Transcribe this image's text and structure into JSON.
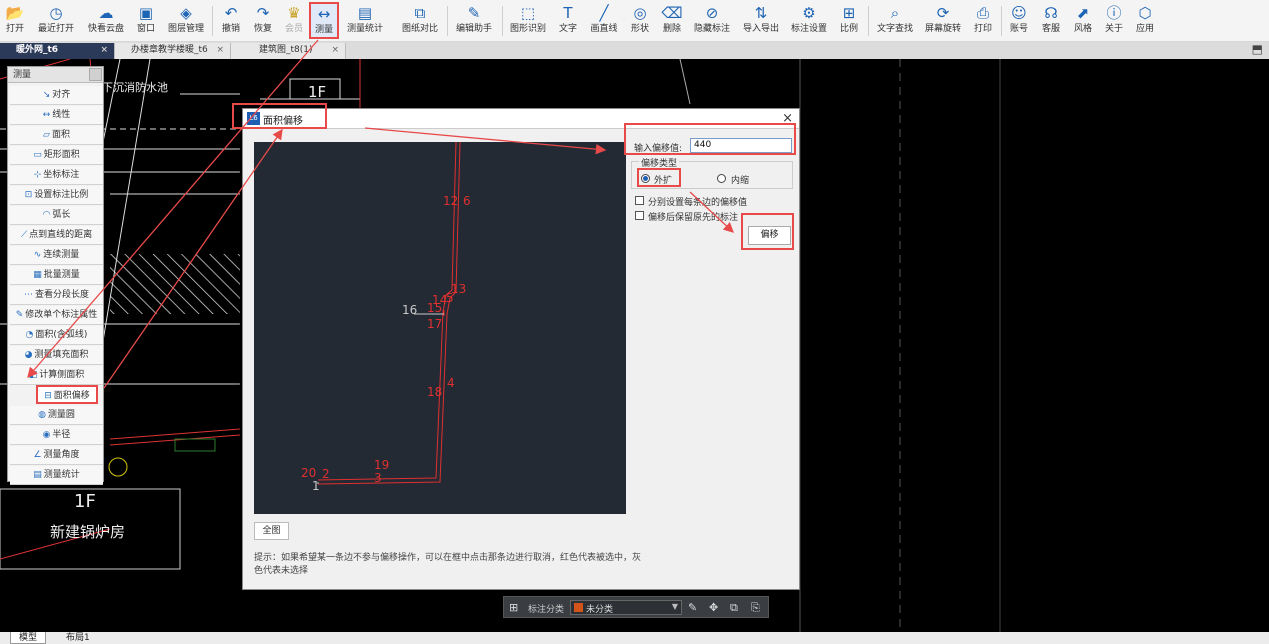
{
  "toolbar": {
    "items": [
      {
        "label": "打开",
        "icon": "folder-icon"
      },
      {
        "label": "最近打开",
        "icon": "clock-icon"
      },
      {
        "label": "快看云盘",
        "icon": "cloud-icon"
      },
      {
        "label": "窗口",
        "icon": "window-icon"
      },
      {
        "label": "图层管理",
        "icon": "layers-icon"
      },
      {
        "label": "撤销",
        "icon": "undo-icon"
      },
      {
        "label": "恢复",
        "icon": "redo-icon"
      },
      {
        "label": "会员",
        "icon": "vip-icon"
      },
      {
        "label": "测量",
        "icon": "measure-icon"
      },
      {
        "label": "测量统计",
        "icon": "measure-stats-icon"
      },
      {
        "label": "图纸对比",
        "icon": "compare-icon"
      },
      {
        "label": "编辑助手",
        "icon": "edit-assistant-icon"
      },
      {
        "label": "图形识别",
        "icon": "shape-recognize-icon"
      },
      {
        "label": "文字",
        "icon": "text-icon"
      },
      {
        "label": "画直线",
        "icon": "line-icon"
      },
      {
        "label": "形状",
        "icon": "shape-icon"
      },
      {
        "label": "删除",
        "icon": "eraser-icon"
      },
      {
        "label": "隐藏标注",
        "icon": "hide-annotation-icon"
      },
      {
        "label": "导入导出",
        "icon": "import-export-icon"
      },
      {
        "label": "标注设置",
        "icon": "annotation-settings-icon"
      },
      {
        "label": "比例",
        "icon": "scale-icon"
      },
      {
        "label": "文字查找",
        "icon": "text-search-icon"
      },
      {
        "label": "屏幕旋转",
        "icon": "rotate-screen-icon"
      },
      {
        "label": "打印",
        "icon": "print-icon"
      },
      {
        "label": "账号",
        "icon": "user-icon"
      },
      {
        "label": "客服",
        "icon": "headset-icon"
      },
      {
        "label": "风格",
        "icon": "style-icon"
      },
      {
        "label": "关于",
        "icon": "info-icon"
      },
      {
        "label": "应用",
        "icon": "cube-icon"
      }
    ]
  },
  "tabs": [
    {
      "label": "暖外网_t6",
      "active": true
    },
    {
      "label": "办楼章教学楼暖_t6",
      "active": false
    },
    {
      "label": "建筑图_t8(1)",
      "active": false
    }
  ],
  "canvas": {
    "labels": {
      "pool": "下沉消防水池",
      "floor_top": "1F",
      "floor_bottom": "1F",
      "boiler": "新建锅炉房"
    }
  },
  "measure_panel": {
    "title": "测量",
    "items": [
      {
        "label": "对齐",
        "icon": "align-icon"
      },
      {
        "label": "线性",
        "icon": "linear-icon"
      },
      {
        "label": "面积",
        "icon": "area-icon"
      },
      {
        "label": "矩形面积",
        "icon": "rect-area-icon"
      },
      {
        "label": "坐标标注",
        "icon": "coordinate-icon"
      },
      {
        "label": "设置标注比例",
        "icon": "scale-setting-icon"
      },
      {
        "label": "弧长",
        "icon": "arc-icon"
      },
      {
        "label": "点到直线的距离",
        "icon": "point-line-icon"
      },
      {
        "label": "连续测量",
        "icon": "continuous-icon"
      },
      {
        "label": "批量测量",
        "icon": "batch-icon"
      },
      {
        "label": "查看分段长度",
        "icon": "segment-icon"
      },
      {
        "label": "修改单个标注属性",
        "icon": "edit-annotation-icon"
      },
      {
        "label": "面积(含弧线)",
        "icon": "arc-area-icon"
      },
      {
        "label": "测量填充面积",
        "icon": "fill-area-icon"
      },
      {
        "label": "计算侧面积",
        "icon": "side-area-icon"
      },
      {
        "label": "面积偏移",
        "icon": "area-offset-icon"
      },
      {
        "label": "测量圆",
        "icon": "circle-icon"
      },
      {
        "label": "半径",
        "icon": "radius-icon"
      },
      {
        "label": "测量角度",
        "icon": "angle-icon"
      },
      {
        "label": "测量统计",
        "icon": "stats-icon"
      }
    ]
  },
  "dialog": {
    "title": "面积偏移",
    "offset_label": "输入偏移值:",
    "offset_value": "440",
    "offset_type_label": "偏移类型",
    "radio_outer": "外扩",
    "radio_inner": "内缩",
    "selected_type": "外扩",
    "checkbox1": "分别设置每条边的偏移值",
    "checkbox2": "偏移后保留原先的标注",
    "offset_button": "偏移",
    "full_button": "全图",
    "hint": "提示：如果希望某一条边不参与偏移操作，可以在框中点击那条边进行取消，红色代表被选中，灰色代表未选择",
    "preview_labels": [
      {
        "text": "12",
        "color": "#e03030"
      },
      {
        "text": "6",
        "color": "#e03030"
      },
      {
        "text": "13",
        "color": "#e03030"
      },
      {
        "text": "14",
        "color": "#e03030"
      },
      {
        "text": "5",
        "color": "#e03030"
      },
      {
        "text": "16",
        "color": "#c8c8c8"
      },
      {
        "text": "15",
        "color": "#e03030"
      },
      {
        "text": "17",
        "color": "#e03030"
      },
      {
        "text": "18",
        "color": "#e03030"
      },
      {
        "text": "4",
        "color": "#e03030"
      },
      {
        "text": "19",
        "color": "#e03030"
      },
      {
        "text": "20",
        "color": "#e03030"
      },
      {
        "text": "2",
        "color": "#e03030"
      },
      {
        "text": "3",
        "color": "#e03030"
      },
      {
        "text": "1",
        "color": "#c8c8c8"
      }
    ]
  },
  "statusbar": {
    "label": "标注分类",
    "select_value": "未分类",
    "swatch_color": "#d2541b"
  },
  "layout_tabs": [
    {
      "label": "模型",
      "active": true
    },
    {
      "label": "布局1",
      "active": false
    }
  ],
  "colors": {
    "highlight": "#e84a4a",
    "accent": "#1e64b4",
    "selected_edge": "#e03030"
  }
}
